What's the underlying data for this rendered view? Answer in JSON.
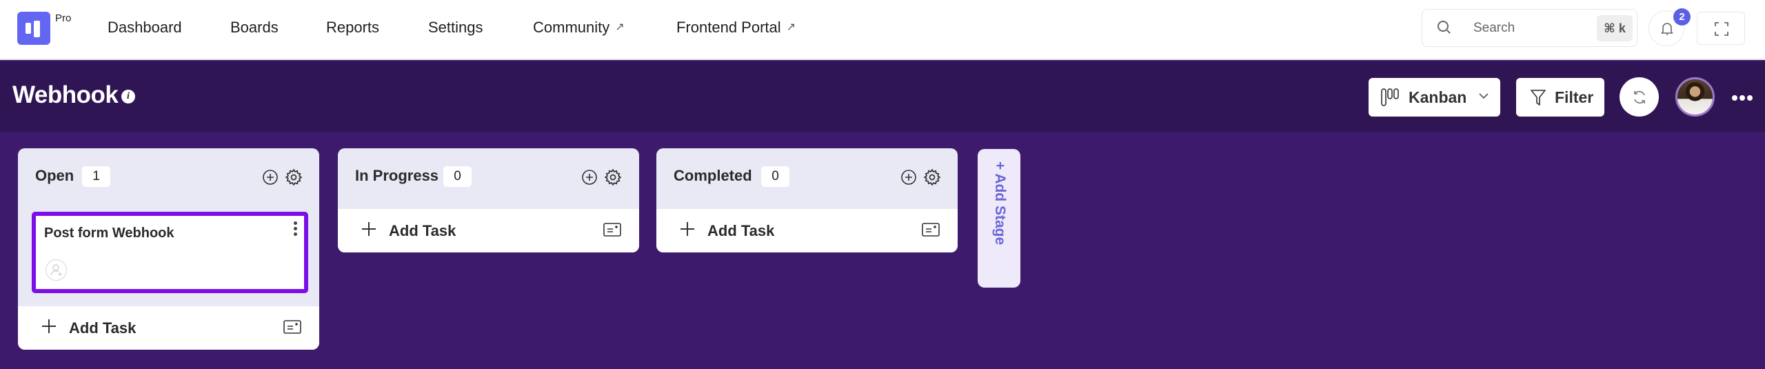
{
  "nav": {
    "logo_badge": "Pro",
    "links": [
      {
        "label": "Dashboard",
        "external": false
      },
      {
        "label": "Boards",
        "external": false
      },
      {
        "label": "Reports",
        "external": false
      },
      {
        "label": "Settings",
        "external": false
      },
      {
        "label": "Community",
        "external": true
      },
      {
        "label": "Frontend Portal",
        "external": true
      }
    ],
    "external_glyph": "↗",
    "search": {
      "placeholder": "Search",
      "shortcut": "⌘ k"
    },
    "notifications": {
      "count": "2",
      "icon": "bell-icon"
    },
    "fullscreen_icon": "fullscreen-icon"
  },
  "header": {
    "title": "Webhook",
    "info_glyph": "i",
    "view_switcher": {
      "label": "Kanban",
      "icon": "kanban-icon"
    },
    "filter": {
      "label": "Filter",
      "icon": "filter-icon"
    },
    "refresh_icon": "refresh-icon",
    "more_icon": "more-horizontal-icon"
  },
  "board": {
    "columns": [
      {
        "name": "Open",
        "count": "1",
        "tasks": [
          {
            "title": "Post form Webhook",
            "selected": true
          }
        ],
        "add_task_label": "Add Task"
      },
      {
        "name": "In Progress",
        "count": "0",
        "tasks": [],
        "add_task_label": "Add Task"
      },
      {
        "name": "Completed",
        "count": "0",
        "tasks": [],
        "add_task_label": "Add Task"
      }
    ],
    "add_stage_label": "+ Add Stage"
  },
  "colors": {
    "brand": "#6366f1",
    "header_bg": "#2f1553",
    "board_bg": "#3e1a6d",
    "selection_border": "#7c0fe8",
    "add_stage_text": "#6b66d9"
  }
}
